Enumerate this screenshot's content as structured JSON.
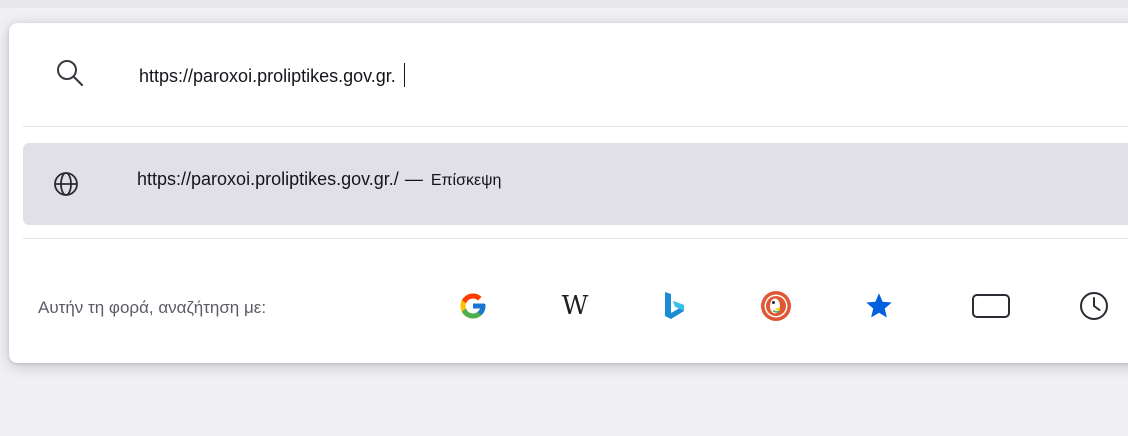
{
  "search": {
    "query": "https://paroxoi.proliptikes.gov.gr."
  },
  "result": {
    "url": "https://paroxoi.proliptikes.gov.gr./",
    "separator": "—",
    "action": "Επίσκεψη"
  },
  "engines": {
    "label": "Αυτήν τη φορά, αναζήτηση με:",
    "wikipedia_glyph": "W",
    "google_glyph": "G",
    "items": [
      {
        "name": "google",
        "icon": "google-icon"
      },
      {
        "name": "wikipedia",
        "icon": "wikipedia-icon"
      },
      {
        "name": "bing",
        "icon": "bing-icon"
      },
      {
        "name": "duckduckgo",
        "icon": "duckduckgo-icon"
      },
      {
        "name": "bookmarks",
        "icon": "star-icon"
      },
      {
        "name": "tabs",
        "icon": "tab-icon"
      },
      {
        "name": "history",
        "icon": "clock-icon"
      }
    ]
  },
  "colors": {
    "background": "#f0f0f4",
    "panel": "#ffffff",
    "selected_row": "#e0e0e6",
    "star": "#0060df",
    "bing": "#1b8bd4",
    "duckduckgo": "#de5833"
  }
}
